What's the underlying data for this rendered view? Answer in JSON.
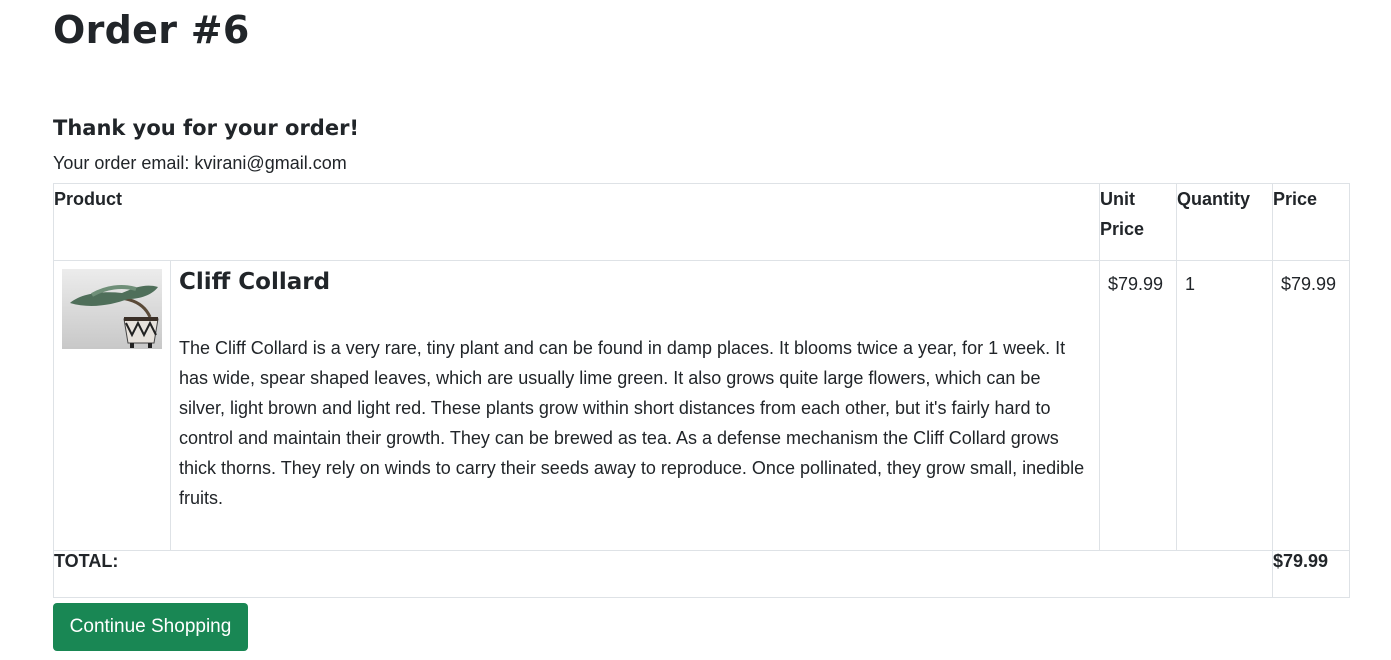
{
  "page": {
    "title": "Order #6",
    "thank_you": "Thank you for your order!",
    "email_label": "Your order email: ",
    "email": "kvirani@gmail.com"
  },
  "table": {
    "headers": {
      "product": "Product",
      "unit_price": "Unit Price",
      "quantity": "Quantity",
      "price": "Price"
    },
    "items": [
      {
        "name": "Cliff Collard",
        "image_icon": "bonsai-plant-image",
        "description": "The Cliff Collard is a very rare, tiny plant and can be found in damp places. It blooms twice a year, for 1 week. It has wide, spear shaped leaves, which are usually lime green. It also grows quite large flowers, which can be silver, light brown and light red. These plants grow within short distances from each other, but it's fairly hard to control and maintain their growth. They can be brewed as tea. As a defense mechanism the Cliff Collard grows thick thorns. They rely on winds to carry their seeds away to reproduce. Once pollinated, they grow small, inedible fruits.",
        "unit_price": "$79.99",
        "quantity": "1",
        "price": "$79.99"
      }
    ],
    "total_label": "TOTAL:",
    "total_value": "$79.99"
  },
  "actions": {
    "continue_label": "Continue Shopping"
  },
  "colors": {
    "primary_button": "#198754",
    "text": "#212529",
    "border": "#dee2e6"
  }
}
